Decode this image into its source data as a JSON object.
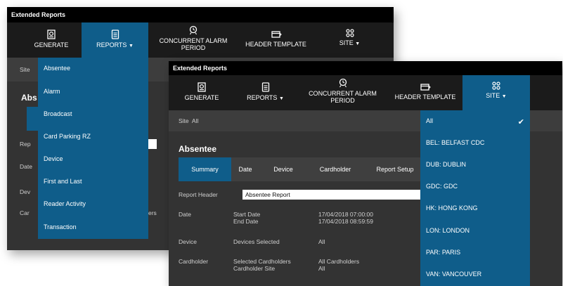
{
  "back": {
    "title": "Extended Reports",
    "toolbar": {
      "generate": "GENERATE",
      "reports": "REPORTS",
      "concurrent_line1": "CONCURRENT ALARM",
      "concurrent_line2": "PERIOD",
      "header_template": "HEADER TEMPLATE",
      "site": "SITE"
    },
    "site_fragment": "Site",
    "panel_title_fragment": "Abs",
    "frag_rep": "Rep",
    "frag_date": "Date",
    "frag_dev": "Dev",
    "frag_car": "Car",
    "frag_ers": "ers",
    "reports_menu": [
      "Absentee",
      "Alarm",
      "Broadcast",
      "Card Parking RZ",
      "Device",
      "First and Last",
      "Reader Activity",
      "Transaction"
    ]
  },
  "front": {
    "title": "Extended Reports",
    "toolbar": {
      "generate": "GENERATE",
      "reports": "REPORTS",
      "concurrent_line1": "CONCURRENT ALARM",
      "concurrent_line2": "PERIOD",
      "header_template": "HEADER TEMPLATE",
      "site": "SITE"
    },
    "site_label": "Site",
    "site_value": "All",
    "panel_title": "Absentee",
    "tabs": [
      "Summary",
      "Date",
      "Device",
      "Cardholder",
      "Report Setup"
    ],
    "rows": {
      "report_header_label": "Report Header",
      "report_header_value": "Absentee Report",
      "date_label": "Date",
      "start_date_label": "Start Date",
      "end_date_label": "End Date",
      "start_date_value": "17/04/2018 07:00:00",
      "end_date_value": "17/04/2018 08:59:59",
      "device_label": "Device",
      "devices_selected_label": "Devices Selected",
      "devices_selected_value": "All",
      "cardholder_label": "Cardholder",
      "selected_cardholders_label": "Selected Cardholders",
      "cardholder_site_label": "Cardholder Site",
      "selected_cardholders_value": "All Cardholders",
      "cardholder_site_value": "All"
    },
    "site_menu": [
      "All",
      "BEL: BELFAST CDC",
      "DUB: DUBLIN",
      "GDC: GDC",
      "HK: HONG KONG",
      "LON: LONDON",
      "PAR: PARIS",
      "VAN: VANCOUVER"
    ],
    "site_menu_checked": "All"
  },
  "icons": {
    "generate": "report-gear-icon",
    "reports": "document-icon",
    "concurrent": "alarm-clock-icon",
    "header_template": "header-template-icon",
    "site": "site-grid-icon",
    "check": "checkmark-icon"
  },
  "colors": {
    "accent": "#0f5d8a",
    "titlebar": "#000000",
    "toolbar": "#1b1b1b",
    "panel": "#333333"
  }
}
